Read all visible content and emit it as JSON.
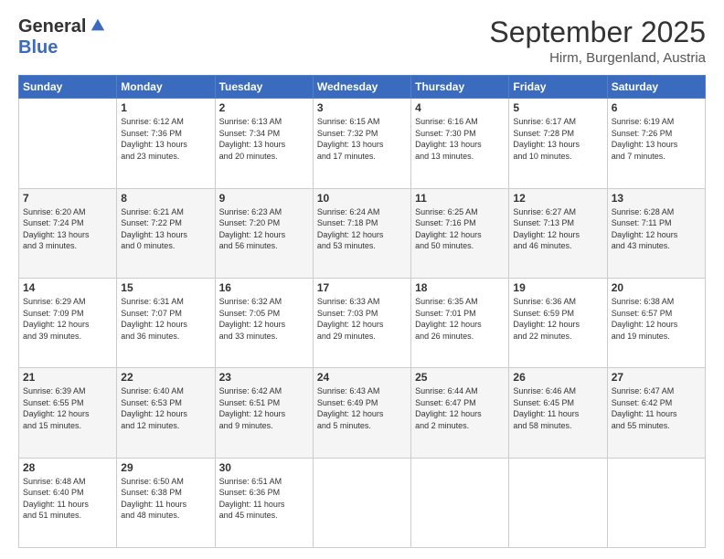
{
  "logo": {
    "general": "General",
    "blue": "Blue"
  },
  "title": "September 2025",
  "location": "Hirm, Burgenland, Austria",
  "days_of_week": [
    "Sunday",
    "Monday",
    "Tuesday",
    "Wednesday",
    "Thursday",
    "Friday",
    "Saturday"
  ],
  "weeks": [
    [
      {
        "day": "",
        "info": ""
      },
      {
        "day": "1",
        "info": "Sunrise: 6:12 AM\nSunset: 7:36 PM\nDaylight: 13 hours\nand 23 minutes."
      },
      {
        "day": "2",
        "info": "Sunrise: 6:13 AM\nSunset: 7:34 PM\nDaylight: 13 hours\nand 20 minutes."
      },
      {
        "day": "3",
        "info": "Sunrise: 6:15 AM\nSunset: 7:32 PM\nDaylight: 13 hours\nand 17 minutes."
      },
      {
        "day": "4",
        "info": "Sunrise: 6:16 AM\nSunset: 7:30 PM\nDaylight: 13 hours\nand 13 minutes."
      },
      {
        "day": "5",
        "info": "Sunrise: 6:17 AM\nSunset: 7:28 PM\nDaylight: 13 hours\nand 10 minutes."
      },
      {
        "day": "6",
        "info": "Sunrise: 6:19 AM\nSunset: 7:26 PM\nDaylight: 13 hours\nand 7 minutes."
      }
    ],
    [
      {
        "day": "7",
        "info": "Sunrise: 6:20 AM\nSunset: 7:24 PM\nDaylight: 13 hours\nand 3 minutes."
      },
      {
        "day": "8",
        "info": "Sunrise: 6:21 AM\nSunset: 7:22 PM\nDaylight: 13 hours\nand 0 minutes."
      },
      {
        "day": "9",
        "info": "Sunrise: 6:23 AM\nSunset: 7:20 PM\nDaylight: 12 hours\nand 56 minutes."
      },
      {
        "day": "10",
        "info": "Sunrise: 6:24 AM\nSunset: 7:18 PM\nDaylight: 12 hours\nand 53 minutes."
      },
      {
        "day": "11",
        "info": "Sunrise: 6:25 AM\nSunset: 7:16 PM\nDaylight: 12 hours\nand 50 minutes."
      },
      {
        "day": "12",
        "info": "Sunrise: 6:27 AM\nSunset: 7:13 PM\nDaylight: 12 hours\nand 46 minutes."
      },
      {
        "day": "13",
        "info": "Sunrise: 6:28 AM\nSunset: 7:11 PM\nDaylight: 12 hours\nand 43 minutes."
      }
    ],
    [
      {
        "day": "14",
        "info": "Sunrise: 6:29 AM\nSunset: 7:09 PM\nDaylight: 12 hours\nand 39 minutes."
      },
      {
        "day": "15",
        "info": "Sunrise: 6:31 AM\nSunset: 7:07 PM\nDaylight: 12 hours\nand 36 minutes."
      },
      {
        "day": "16",
        "info": "Sunrise: 6:32 AM\nSunset: 7:05 PM\nDaylight: 12 hours\nand 33 minutes."
      },
      {
        "day": "17",
        "info": "Sunrise: 6:33 AM\nSunset: 7:03 PM\nDaylight: 12 hours\nand 29 minutes."
      },
      {
        "day": "18",
        "info": "Sunrise: 6:35 AM\nSunset: 7:01 PM\nDaylight: 12 hours\nand 26 minutes."
      },
      {
        "day": "19",
        "info": "Sunrise: 6:36 AM\nSunset: 6:59 PM\nDaylight: 12 hours\nand 22 minutes."
      },
      {
        "day": "20",
        "info": "Sunrise: 6:38 AM\nSunset: 6:57 PM\nDaylight: 12 hours\nand 19 minutes."
      }
    ],
    [
      {
        "day": "21",
        "info": "Sunrise: 6:39 AM\nSunset: 6:55 PM\nDaylight: 12 hours\nand 15 minutes."
      },
      {
        "day": "22",
        "info": "Sunrise: 6:40 AM\nSunset: 6:53 PM\nDaylight: 12 hours\nand 12 minutes."
      },
      {
        "day": "23",
        "info": "Sunrise: 6:42 AM\nSunset: 6:51 PM\nDaylight: 12 hours\nand 9 minutes."
      },
      {
        "day": "24",
        "info": "Sunrise: 6:43 AM\nSunset: 6:49 PM\nDaylight: 12 hours\nand 5 minutes."
      },
      {
        "day": "25",
        "info": "Sunrise: 6:44 AM\nSunset: 6:47 PM\nDaylight: 12 hours\nand 2 minutes."
      },
      {
        "day": "26",
        "info": "Sunrise: 6:46 AM\nSunset: 6:45 PM\nDaylight: 11 hours\nand 58 minutes."
      },
      {
        "day": "27",
        "info": "Sunrise: 6:47 AM\nSunset: 6:42 PM\nDaylight: 11 hours\nand 55 minutes."
      }
    ],
    [
      {
        "day": "28",
        "info": "Sunrise: 6:48 AM\nSunset: 6:40 PM\nDaylight: 11 hours\nand 51 minutes."
      },
      {
        "day": "29",
        "info": "Sunrise: 6:50 AM\nSunset: 6:38 PM\nDaylight: 11 hours\nand 48 minutes."
      },
      {
        "day": "30",
        "info": "Sunrise: 6:51 AM\nSunset: 6:36 PM\nDaylight: 11 hours\nand 45 minutes."
      },
      {
        "day": "",
        "info": ""
      },
      {
        "day": "",
        "info": ""
      },
      {
        "day": "",
        "info": ""
      },
      {
        "day": "",
        "info": ""
      }
    ]
  ],
  "colors": {
    "header_bg": "#3a6bbf",
    "shaded_row": "#f5f5f5"
  }
}
